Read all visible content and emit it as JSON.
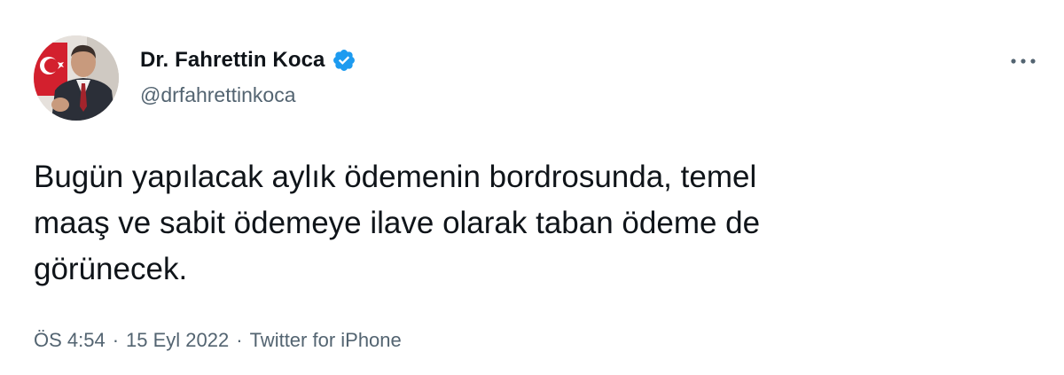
{
  "author": {
    "display_name": "Dr. Fahrettin Koca",
    "handle": "@drfahrettinkoca",
    "verified": true,
    "avatar_icon": "profile-photo"
  },
  "actions": {
    "more_icon": "ellipsis-icon"
  },
  "tweet": {
    "text": "Bugün yapılacak aylık ödemenin bordrosunda, temel\nmaaş ve sabit ödemeye ilave olarak taban ödeme de\ngörünecek."
  },
  "meta": {
    "time": "ÖS 4:54",
    "separator": "·",
    "date": "15 Eyl 2022",
    "source": "Twitter for iPhone"
  },
  "colors": {
    "text_primary": "#0f1419",
    "text_secondary": "#536471",
    "verified_blue": "#1d9bf0",
    "background": "#ffffff"
  }
}
